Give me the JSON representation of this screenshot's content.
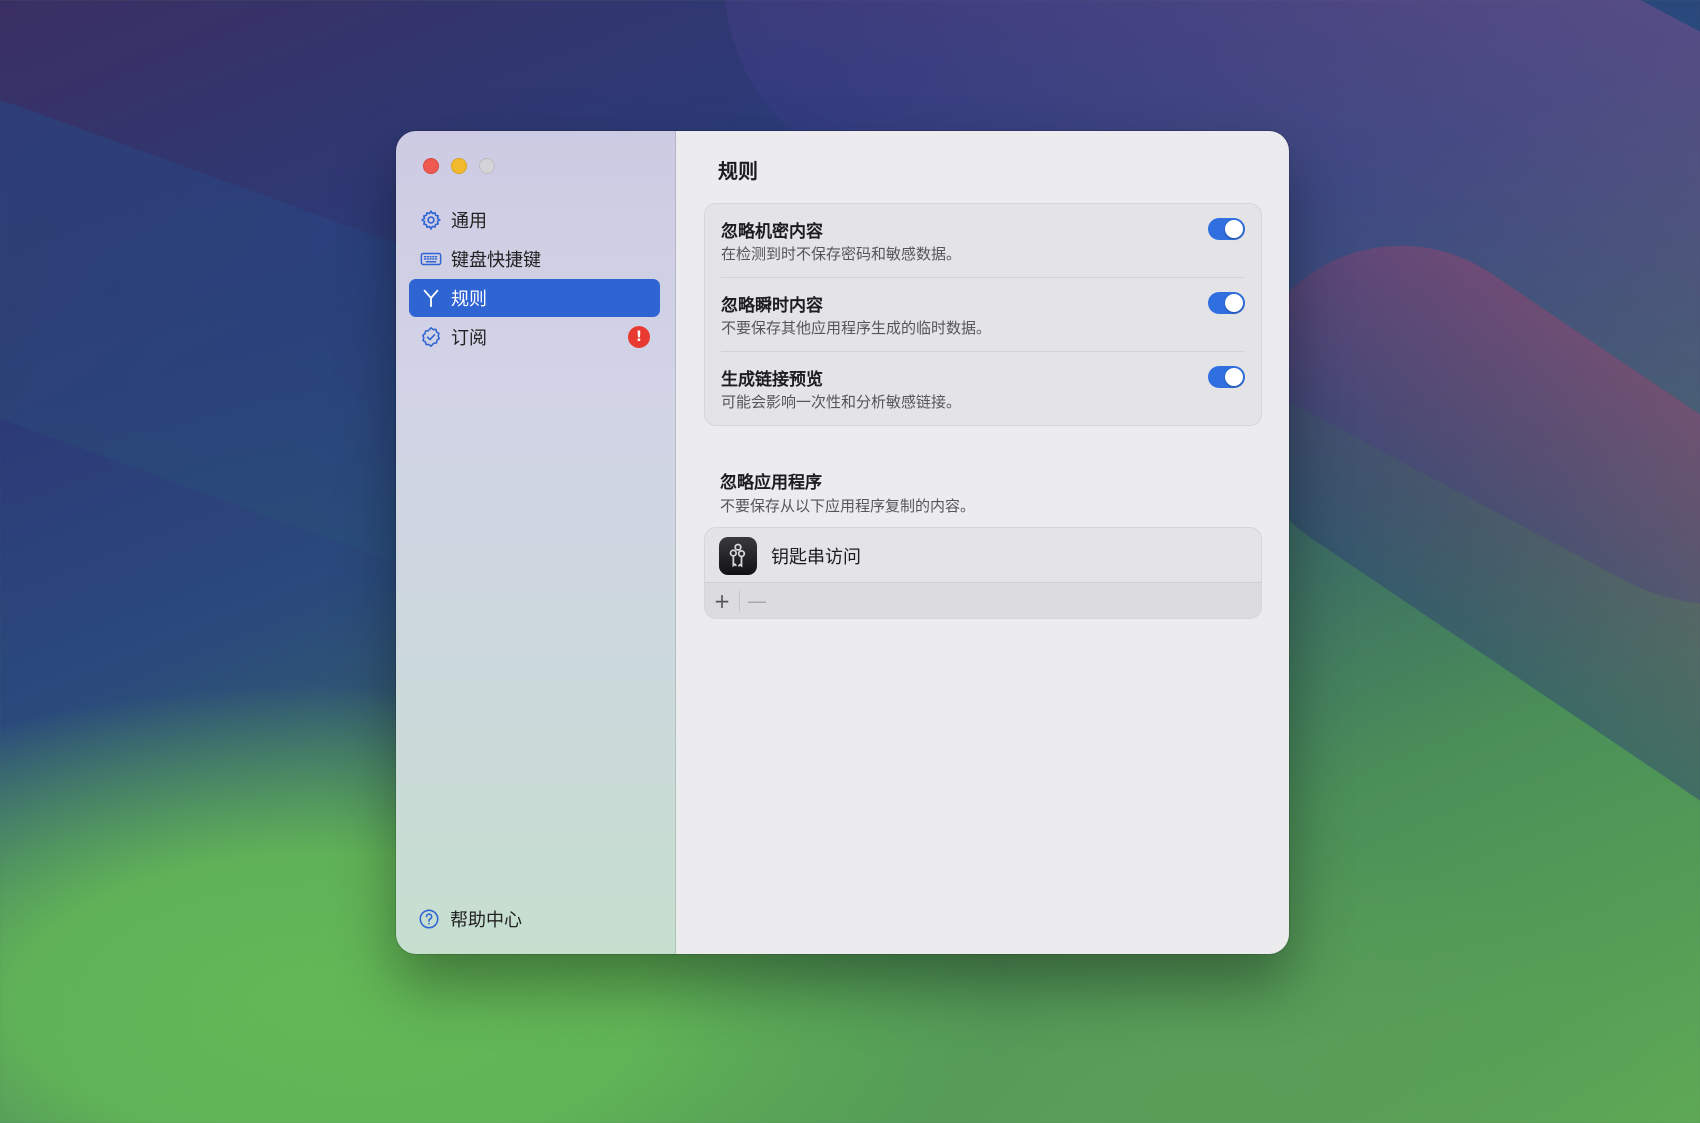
{
  "sidebar": {
    "items": [
      {
        "label": "通用",
        "icon": "gear-icon",
        "active": false
      },
      {
        "label": "键盘快捷键",
        "icon": "keyboard-icon",
        "active": false
      },
      {
        "label": "规则",
        "icon": "branch-icon",
        "active": true
      },
      {
        "label": "订阅",
        "icon": "verified-badge-icon",
        "active": false,
        "badge": "!"
      }
    ],
    "help_label": "帮助中心"
  },
  "main": {
    "title": "规则",
    "rules": [
      {
        "title": "忽略机密内容",
        "description": "在检测到时不保存密码和敏感数据。",
        "enabled": true
      },
      {
        "title": "忽略瞬时内容",
        "description": "不要保存其他应用程序生成的临时数据。",
        "enabled": true
      },
      {
        "title": "生成链接预览",
        "description": "可能会影响一次性和分析敏感链接。",
        "enabled": true
      }
    ],
    "ignored_apps": {
      "title": "忽略应用程序",
      "description": "不要保存从以下应用程序复制的内容。",
      "apps": [
        {
          "name": "钥匙串访问",
          "icon": "keychain-icon"
        }
      ],
      "add_label": "+",
      "remove_label": "—"
    }
  },
  "colors": {
    "accent": "#2f64d3",
    "toggle_on": "#2f6fe0",
    "badge": "#e83a30"
  }
}
